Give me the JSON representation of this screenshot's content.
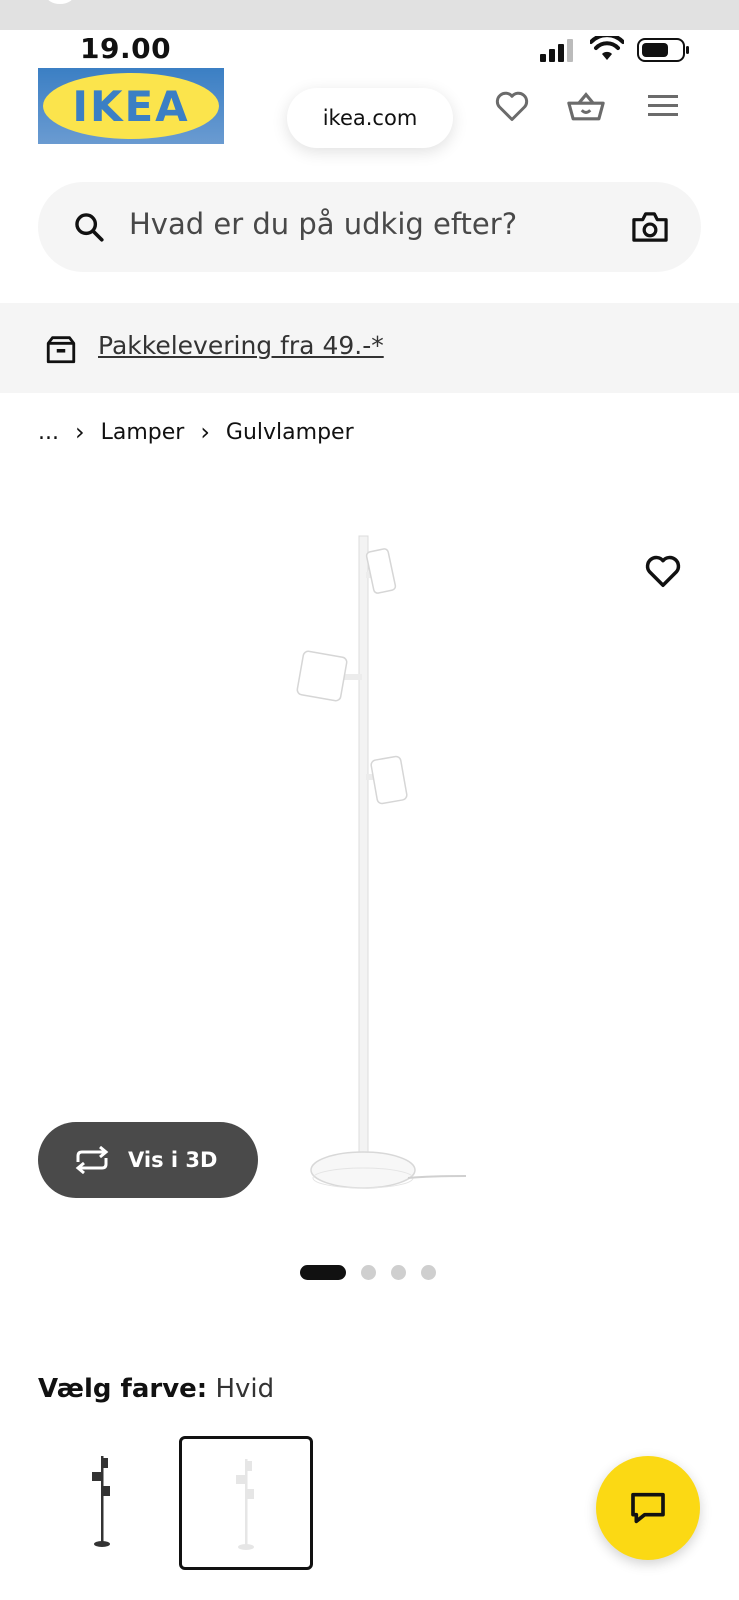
{
  "status": {
    "time": "19.00"
  },
  "header": {
    "logo_text": "IKEA",
    "url": "ikea.com",
    "icons": [
      "heart-icon",
      "basket-icon",
      "menu-icon"
    ]
  },
  "search": {
    "placeholder": "Hvad er du på udkig efter?",
    "icons": [
      "search-icon",
      "camera-icon"
    ]
  },
  "banner": {
    "text": "Pakkelevering fra 49.-*"
  },
  "breadcrumb": {
    "items": [
      "...",
      "Lamper",
      "Gulvlamper"
    ]
  },
  "product": {
    "view_3d_label": "Vis i 3D",
    "carousel": {
      "count": 4,
      "active": 1
    }
  },
  "color": {
    "label": "Vælg farve:",
    "value": "Hvid",
    "options": [
      "sort",
      "hvid"
    ],
    "selected": "hvid"
  },
  "colors": {
    "brand_blue": "#0058a3",
    "brand_yellow": "#fbd914",
    "button_dark": "#4a4a4a"
  }
}
